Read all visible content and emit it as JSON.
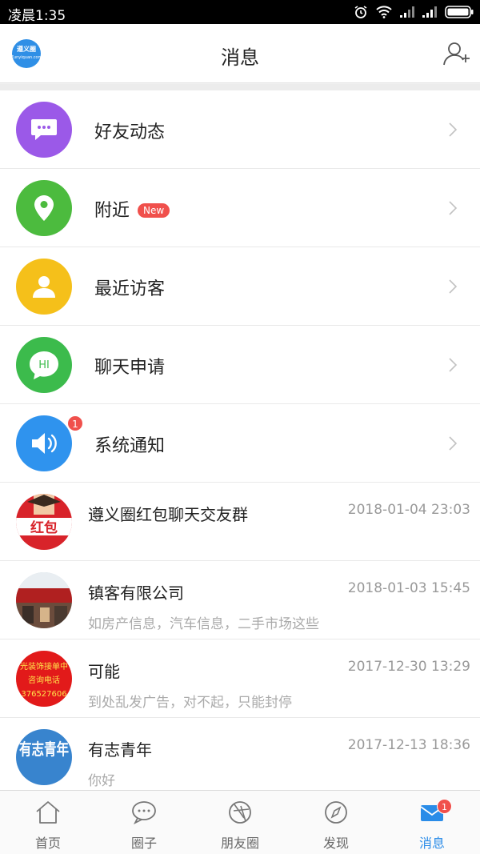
{
  "status_bar": {
    "time": "凌晨1:35"
  },
  "header": {
    "title": "消息",
    "logo_text": "遵义圈",
    "logo_subtext": "Zunyiquan.com"
  },
  "menu": [
    {
      "label": "好友动态",
      "icon": "chat-bubble-icon",
      "color": "#9b59e8"
    },
    {
      "label": "附近",
      "icon": "location-pin-icon",
      "color": "#4cbb3e",
      "badge": "New"
    },
    {
      "label": "最近访客",
      "icon": "person-icon",
      "color": "#f5c01a"
    },
    {
      "label": "聊天申请",
      "icon": "hi-bubble-icon",
      "color": "#3cbb4c",
      "icon_text": "HI"
    },
    {
      "label": "系统通知",
      "icon": "speaker-icon",
      "color": "#2f93ee",
      "count": "1"
    }
  ],
  "chats": [
    {
      "name": "遵义圈红包聊天交友群",
      "time": "2018-01-04 23:03",
      "preview": "",
      "avatar_text": "红包",
      "avatar_color": "#d8232a"
    },
    {
      "name": "镇客有限公司",
      "time": "2018-01-03 15:45",
      "preview": "如房产信息，汽车信息，二手市场这些",
      "avatar_color": "#8a4a3a"
    },
    {
      "name": "可能",
      "time": "2017-12-30 13:29",
      "preview": "到处乱发广告，对不起，只能封停",
      "avatar_lines": [
        "光装饰接单中",
        "咨询电话",
        "376527606"
      ],
      "avatar_color": "#e21a1a"
    },
    {
      "name": "有志青年",
      "time": "2017-12-13 18:36",
      "preview": "你好",
      "avatar_text": "有志青年",
      "avatar_color": "#2277c9"
    }
  ],
  "tabs": [
    {
      "label": "首页",
      "icon": "home-icon"
    },
    {
      "label": "圈子",
      "icon": "circle-chat-icon"
    },
    {
      "label": "朋友圈",
      "icon": "aperture-icon"
    },
    {
      "label": "发现",
      "icon": "compass-icon"
    },
    {
      "label": "消息",
      "icon": "mail-icon",
      "active": true,
      "badge": "1"
    }
  ],
  "colors": {
    "accent": "#2a8ce8",
    "badge": "#f0504c"
  }
}
